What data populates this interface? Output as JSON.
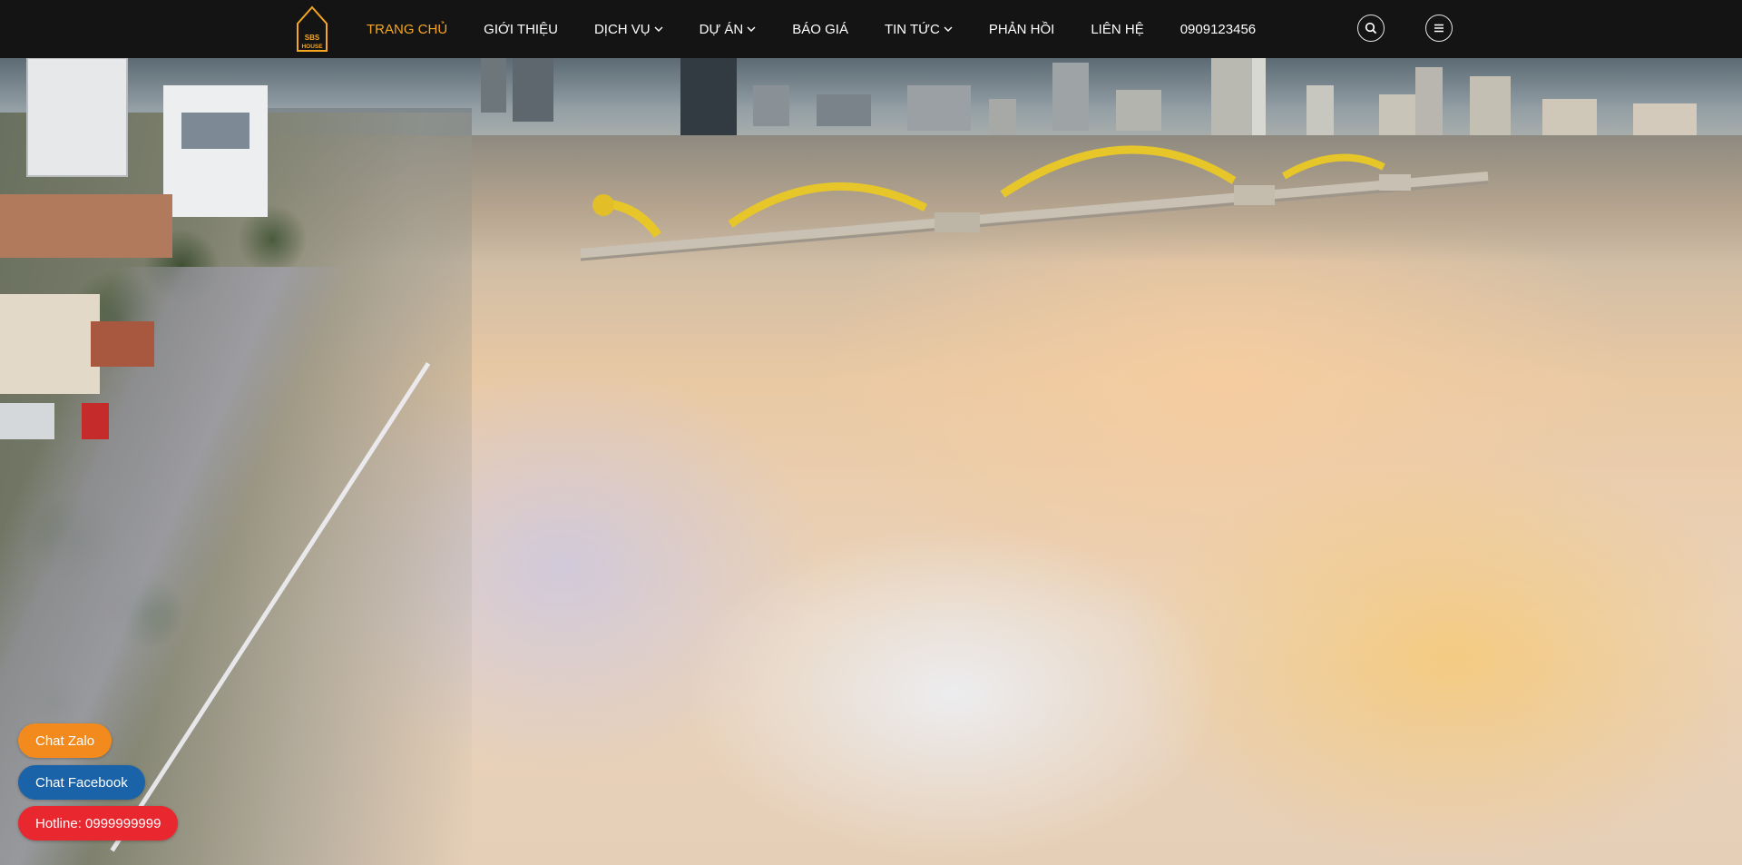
{
  "header": {
    "logo_lines": [
      "SBS",
      "HOUSE"
    ],
    "nav": [
      {
        "label": "TRANG CHỦ",
        "active": true,
        "has_dropdown": false
      },
      {
        "label": "GIỚI THIỆU",
        "active": false,
        "has_dropdown": false
      },
      {
        "label": "DỊCH VỤ",
        "active": false,
        "has_dropdown": true
      },
      {
        "label": "DỰ ÁN",
        "active": false,
        "has_dropdown": true
      },
      {
        "label": "BÁO GIÁ",
        "active": false,
        "has_dropdown": false
      },
      {
        "label": "TIN TỨC",
        "active": false,
        "has_dropdown": true
      },
      {
        "label": "PHẢN HỒI",
        "active": false,
        "has_dropdown": false
      },
      {
        "label": "LIÊN HỆ",
        "active": false,
        "has_dropdown": false
      },
      {
        "label": "0909123456",
        "active": false,
        "has_dropdown": false
      }
    ],
    "search_icon": "search-icon",
    "menu_icon": "hamburger-menu-icon"
  },
  "floating": {
    "zalo_label": "Chat Zalo",
    "facebook_label": "Chat Facebook",
    "hotline_label": "Hotline: 0999999999"
  },
  "colors": {
    "header_bg": "#141414",
    "accent": "#f5a623",
    "zalo": "#f28a1e",
    "facebook": "#1a63a8",
    "hotline": "#e8272f"
  }
}
